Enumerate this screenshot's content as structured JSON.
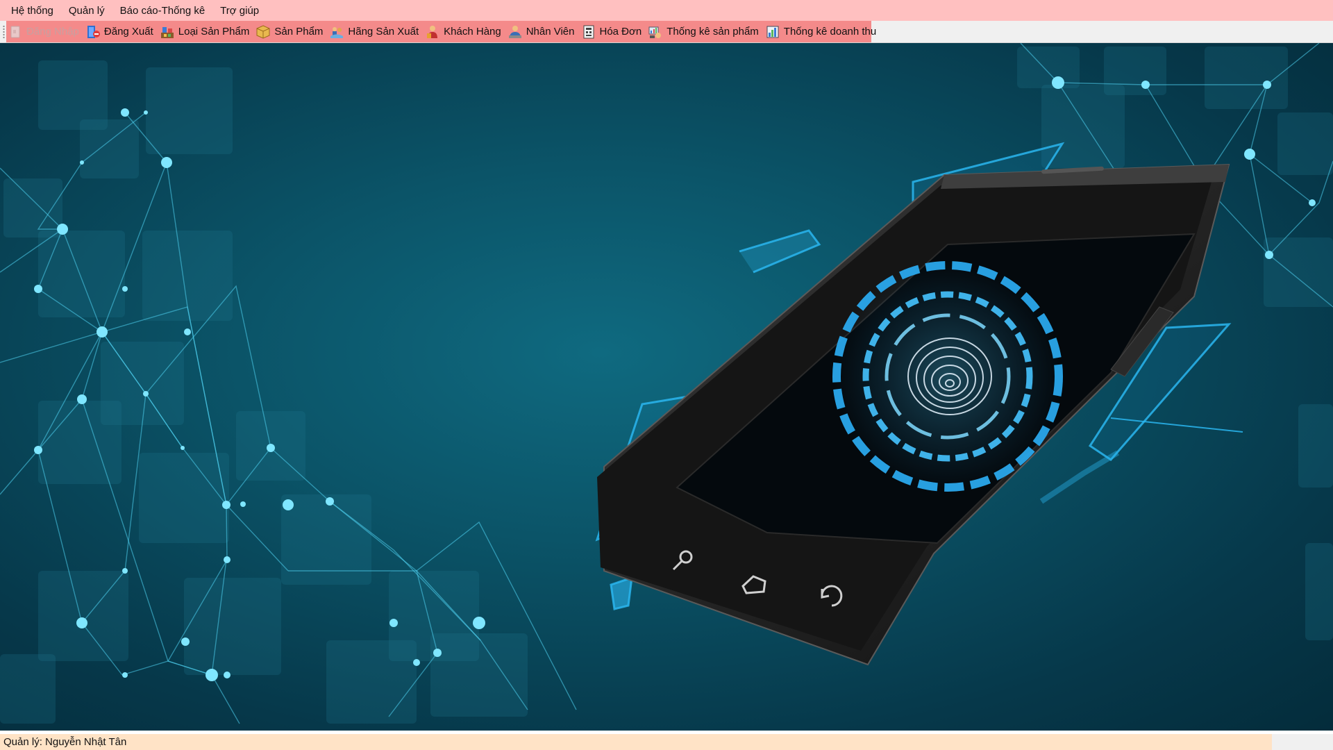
{
  "menubar": {
    "items": [
      {
        "label": "Hệ thống"
      },
      {
        "label": "Quản lý"
      },
      {
        "label": "Báo cáo-Thống kê"
      },
      {
        "label": "Trợ giúp"
      }
    ]
  },
  "toolbar": {
    "buttons": [
      {
        "label": "Đăng Nhập",
        "icon": "login-icon",
        "enabled": false
      },
      {
        "label": "Đăng Xuất",
        "icon": "logout-icon",
        "enabled": true
      },
      {
        "label": "Loại Sản Phẩm",
        "icon": "product-type-icon",
        "enabled": true
      },
      {
        "label": "Sản Phẩm",
        "icon": "product-box-icon",
        "enabled": true
      },
      {
        "label": "Hãng Sản Xuất",
        "icon": "manufacturer-icon",
        "enabled": true
      },
      {
        "label": "Khách Hàng",
        "icon": "customer-icon",
        "enabled": true
      },
      {
        "label": "Nhân Viên",
        "icon": "employee-icon",
        "enabled": true
      },
      {
        "label": "Hóa Đơn",
        "icon": "invoice-icon",
        "enabled": true
      },
      {
        "label": "Thống kê sản phẩm",
        "icon": "product-stats-icon",
        "enabled": true
      },
      {
        "label": "Thống kê doanh thu",
        "icon": "revenue-stats-icon",
        "enabled": true
      }
    ]
  },
  "statusbar": {
    "user_text": "Quản lý: Nguyễn Nhật Tân"
  },
  "colors": {
    "menubar_bg": "#ffc0c0",
    "toolbar_bg": "#f48a8a",
    "status_bg": "#ffe3c6",
    "content_bg": "#0b5468",
    "accent": "#27b4f0"
  }
}
